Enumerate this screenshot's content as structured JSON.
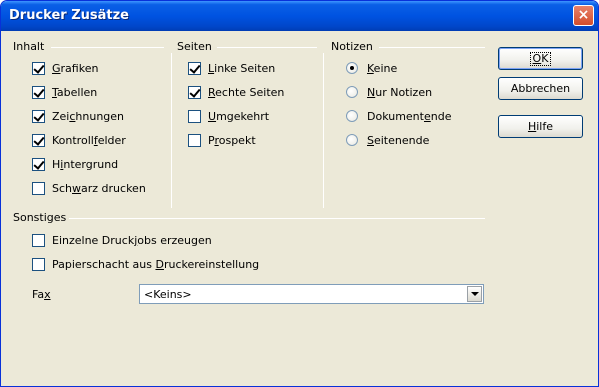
{
  "window": {
    "title": "Drucker Zusätze",
    "close_label": "×"
  },
  "inhalt": {
    "label": "Inhalt",
    "items": [
      {
        "pre": "",
        "key": "G",
        "post": "rafiken",
        "checked": true
      },
      {
        "pre": "",
        "key": "T",
        "post": "abellen",
        "checked": true
      },
      {
        "pre": "Zei",
        "key": "c",
        "post": "hnungen",
        "checked": true
      },
      {
        "pre": "Kontroll",
        "key": "f",
        "post": "elder",
        "checked": true
      },
      {
        "pre": "H",
        "key": "i",
        "post": "ntergrund",
        "checked": true
      },
      {
        "pre": "Sch",
        "key": "w",
        "post": "arz drucken",
        "checked": false
      }
    ]
  },
  "seiten": {
    "label": "Seiten",
    "items": [
      {
        "pre": "",
        "key": "L",
        "post": "inke Seiten",
        "checked": true
      },
      {
        "pre": "",
        "key": "R",
        "post": "echte Seiten",
        "checked": true
      },
      {
        "pre": "",
        "key": "U",
        "post": "mgekehrt",
        "checked": false
      },
      {
        "pre": "P",
        "key": "r",
        "post": "ospekt",
        "checked": false
      }
    ]
  },
  "notizen": {
    "label": "Notizen",
    "items": [
      {
        "pre": "",
        "key": "K",
        "post": "eine",
        "selected": true
      },
      {
        "pre": "",
        "key": "N",
        "post": "ur Notizen",
        "selected": false
      },
      {
        "pre": "Dokument",
        "key": "e",
        "post": "nde",
        "selected": false
      },
      {
        "pre": "",
        "key": "S",
        "post": "eitenende",
        "selected": false
      }
    ]
  },
  "sonstiges": {
    "label": "Sonstiges",
    "items": [
      {
        "pre": "Einzelne Druck",
        "key": "j",
        "post": "obs erzeugen",
        "checked": false
      },
      {
        "pre": "Papierschacht aus ",
        "key": "D",
        "post": "ruckereinstellung",
        "checked": false
      }
    ],
    "fax_pre": "Fa",
    "fax_key": "x",
    "fax_value": "<Keins>"
  },
  "buttons": {
    "ok_key": "O",
    "ok_post": "K",
    "cancel": "Abbrechen",
    "help_key": "H",
    "help_post": "ilfe"
  }
}
